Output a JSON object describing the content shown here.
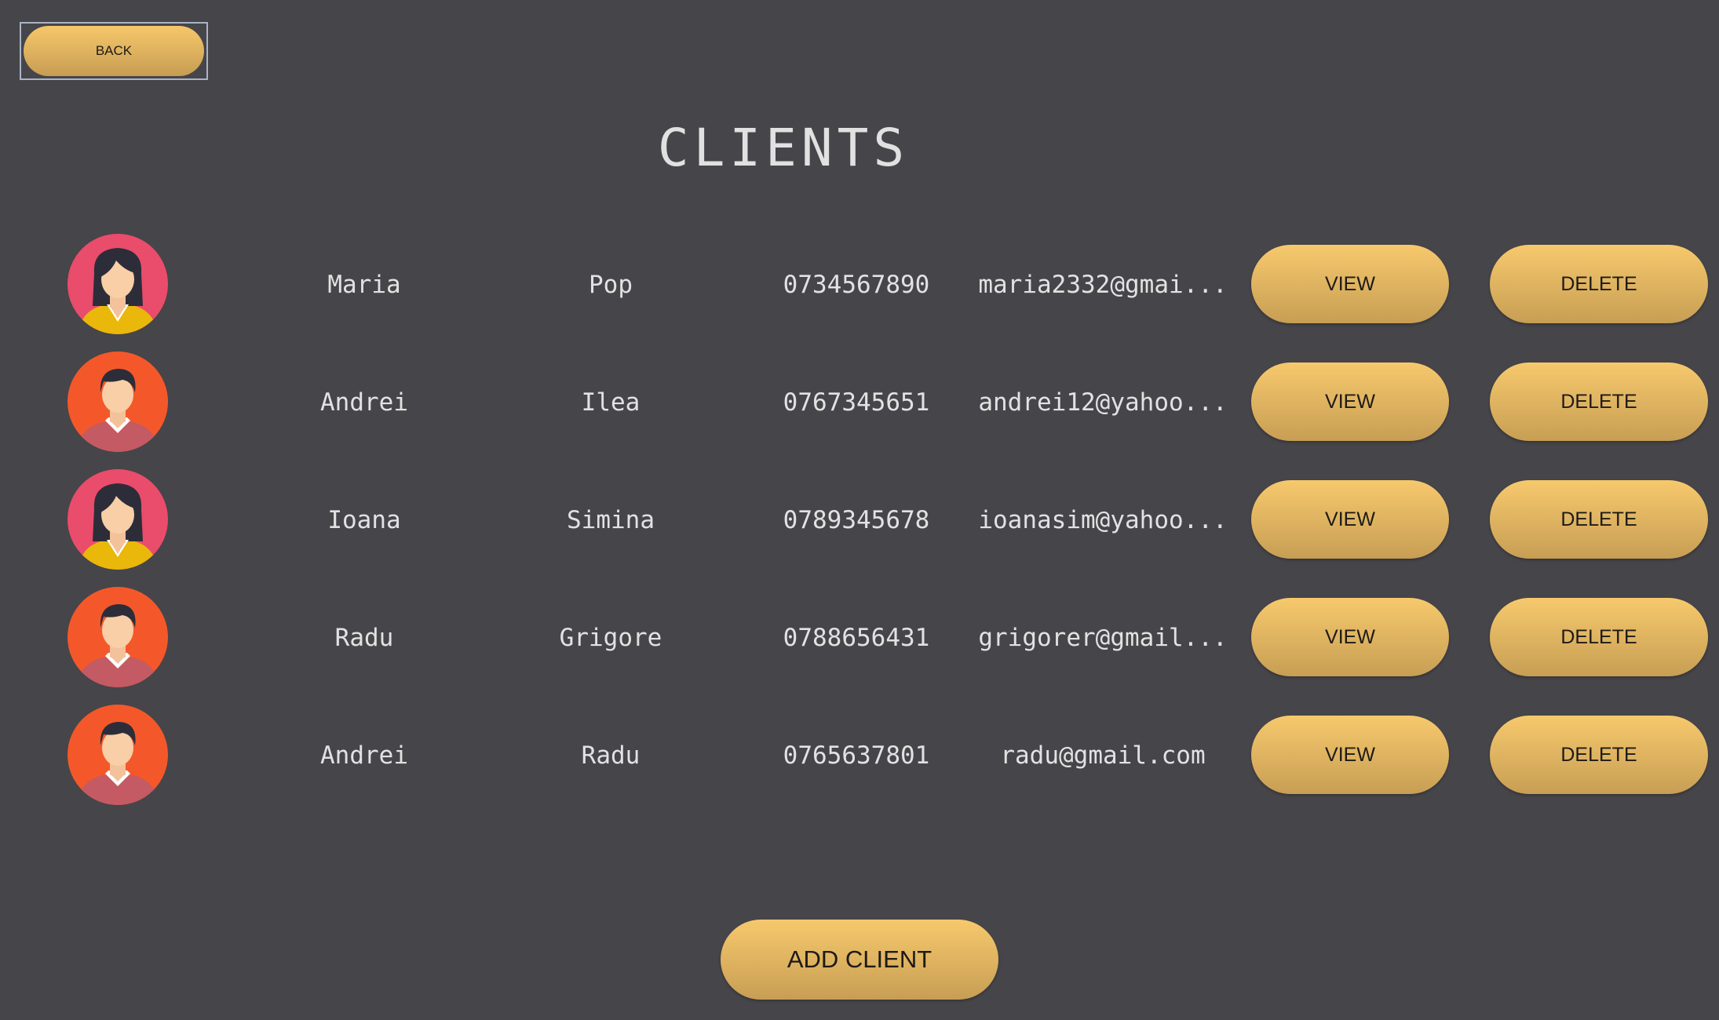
{
  "header": {
    "back_label": "BACK",
    "title": "CLIENTS"
  },
  "clients": [
    {
      "first_name": "Maria",
      "last_name": "Pop",
      "phone": "0734567890",
      "email": "maria2332@gmai...",
      "avatar": "female-avatar-icon"
    },
    {
      "first_name": "Andrei",
      "last_name": "Ilea",
      "phone": "0767345651",
      "email": "andrei12@yahoo...",
      "avatar": "male-avatar-icon"
    },
    {
      "first_name": "Ioana",
      "last_name": "Simina",
      "phone": "0789345678",
      "email": "ioanasim@yahoo...",
      "avatar": "female-avatar-icon"
    },
    {
      "first_name": "Radu",
      "last_name": "Grigore",
      "phone": "0788656431",
      "email": "grigorer@gmail...",
      "avatar": "male-avatar-icon"
    },
    {
      "first_name": "Andrei",
      "last_name": "Radu",
      "phone": "0765637801",
      "email": "radu@gmail.com",
      "avatar": "male-avatar-icon"
    }
  ],
  "actions": {
    "view_label": "VIEW",
    "delete_label": "DELETE",
    "add_label": "ADD CLIENT"
  },
  "colors": {
    "background": "#464549",
    "button_gold": "#f0c167",
    "female_avatar_bg": "#ea4c6b",
    "male_avatar_bg": "#f4582a"
  }
}
